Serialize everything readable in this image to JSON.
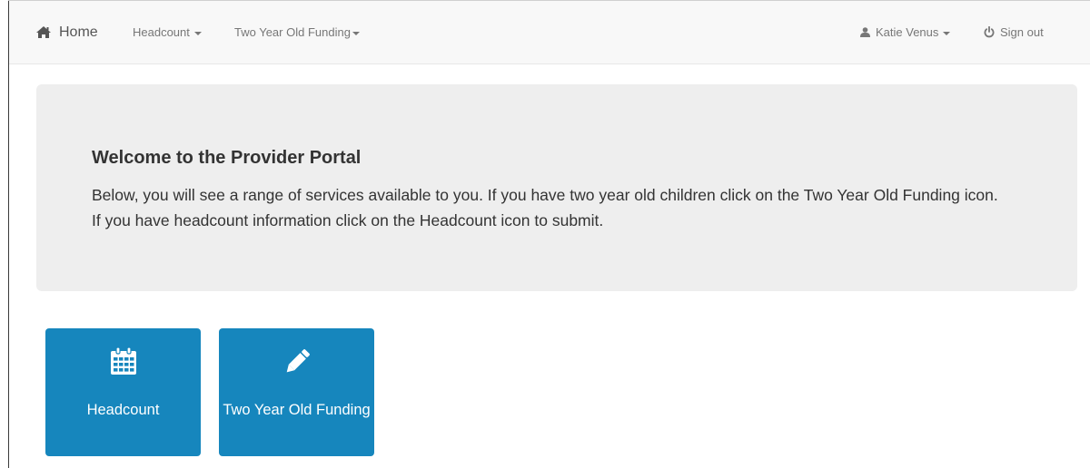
{
  "navbar": {
    "home_label": "Home",
    "headcount_label": "Headcount",
    "two_year_old_funding_label": "Two Year Old Funding",
    "user_label": "Katie Venus",
    "signout_label": "Sign out"
  },
  "jumbotron": {
    "title": "Welcome to the Provider Portal",
    "body": "Below, you will see a range of services available to you. If you have two year old children click on the Two Year Old Funding icon. If you have headcount information click on the Headcount icon to submit."
  },
  "tiles": [
    {
      "label": "Headcount",
      "icon": "calendar-icon"
    },
    {
      "label": "Two Year Old Funding",
      "icon": "pencil-icon"
    }
  ],
  "colors": {
    "navbar_bg": "#f8f8f8",
    "jumbotron_bg": "#eeeeee",
    "tile_bg": "#1686bd",
    "tile_text": "#ffffff"
  }
}
